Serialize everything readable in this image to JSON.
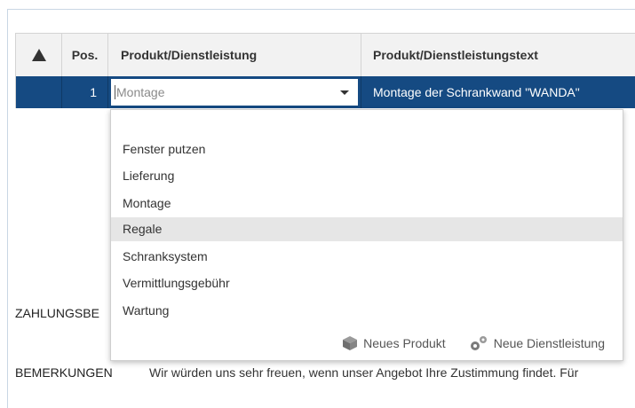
{
  "table": {
    "headers": {
      "warning_icon": "warning-triangle-icon",
      "pos": "Pos.",
      "product": "Produkt/Dienstleistung",
      "product_text": "Produkt/Dienstleistungstext"
    },
    "row": {
      "pos": "1",
      "product_value": "Montage",
      "product_text": "Montage der Schrankwand \"WANDA\""
    }
  },
  "dropdown": {
    "options": [
      "Fenster putzen",
      "Lieferung",
      "Montage",
      "Regale",
      "Schranksystem",
      "Vermittlungsgebühr",
      "Wartung"
    ],
    "hovered_option": "Regale",
    "new_product_label": "Neues Produkt",
    "new_service_label": "Neue Dienstleistung"
  },
  "labels": {
    "zahlungsbedingungen": "ZAHLUNGSBE",
    "bemerkungen": "BEMERKUNGEN",
    "bemerkungen_text": "Wir würden uns sehr freuen, wenn unser Angebot Ihre Zustimmung findet. Für"
  },
  "colors": {
    "row_selected": "#154a82",
    "header_bg": "#f2f2f2",
    "hover_bg": "#e6e6e6"
  }
}
